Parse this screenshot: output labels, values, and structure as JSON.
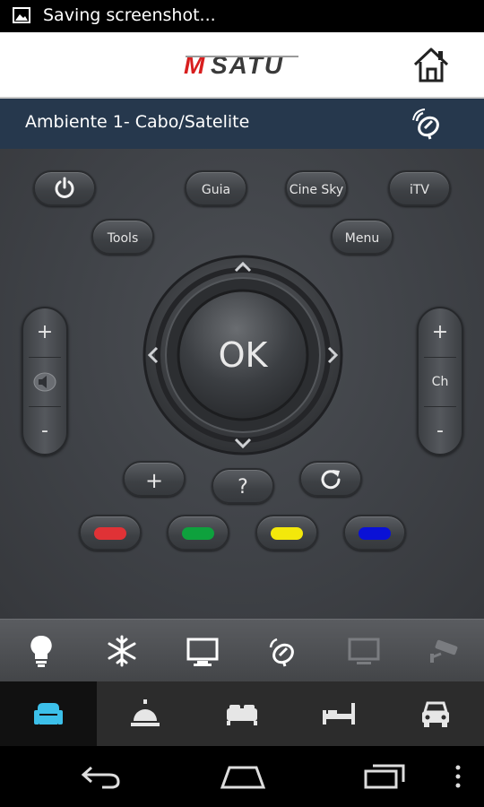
{
  "status_bar": {
    "text": "Saving screenshot..."
  },
  "app_bar": {
    "logo_text": "MSATU"
  },
  "title_bar": {
    "title": "Ambiente 1- Cabo/Satelite"
  },
  "remote": {
    "buttons": {
      "guia": "Guia",
      "cine_sky": "Cine Sky",
      "itv": "iTV",
      "tools": "Tools",
      "menu": "Menu",
      "ok": "OK",
      "plus": "+",
      "help": "?"
    },
    "volume": {
      "up": "+",
      "down": "-"
    },
    "channel": {
      "up": "+",
      "label": "Ch",
      "down": "-"
    },
    "color_buttons": [
      "#e03236",
      "#0ea13d",
      "#f3e80b",
      "#0a11d6"
    ]
  },
  "dock": {
    "icons": [
      "lightbulb-icon",
      "snowflake-icon",
      "monitor-icon",
      "satellite-dish-icon",
      "tv-icon",
      "camera-icon"
    ],
    "active_color": "#ffffff",
    "inactive_color": "#7a7c80"
  },
  "room_tabs": {
    "items": [
      "armchair-icon",
      "service-bell-icon",
      "bed-icon",
      "single-bed-icon",
      "car-icon"
    ],
    "active_color": "#3cc0ea"
  },
  "navigation_bar": {
    "items": [
      "back-icon",
      "home-icon",
      "recent-apps-icon",
      "overflow-menu-icon"
    ]
  }
}
